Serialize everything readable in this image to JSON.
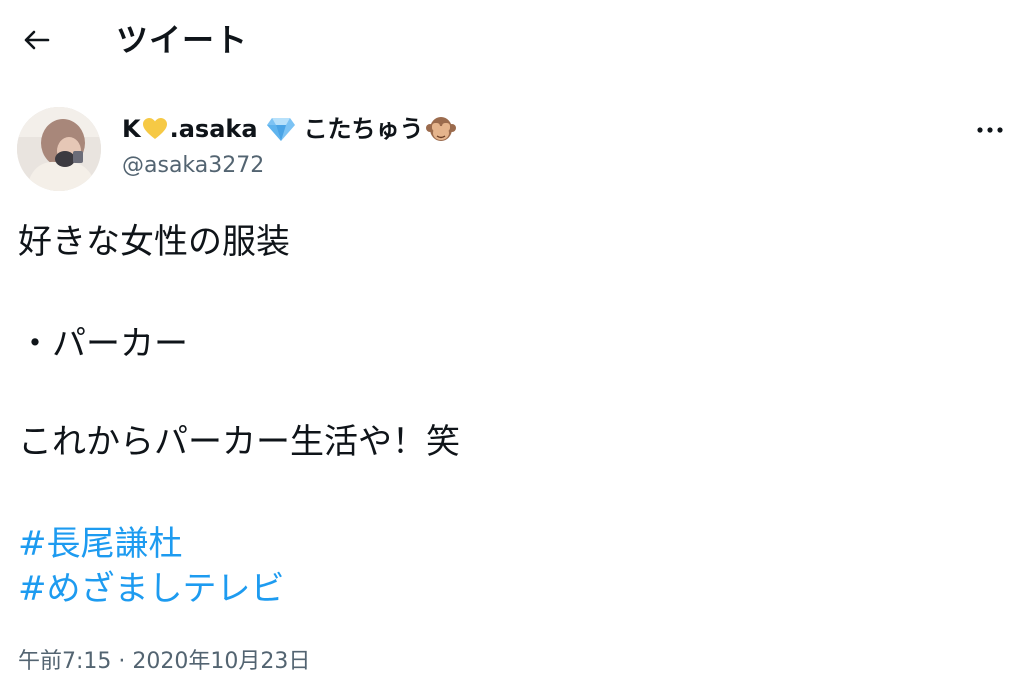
{
  "header": {
    "title": "ツイート",
    "back_icon": "arrow-left-icon"
  },
  "author": {
    "name_prefix": "K",
    "name_main": ".asaka",
    "name_suffix": "こたちゅう",
    "handle": "@asaka3272",
    "name_emoji_icons": [
      "yellow-heart-icon",
      "gem-icon",
      "see-no-evil-monkey-icon"
    ],
    "avatar_icon": "avatar"
  },
  "more_icon": "more-horizontal-icon",
  "tweet": {
    "line1": "好きな女性の服装",
    "line2": "・パーカー",
    "line3": "これからパーカー生活や！笑",
    "hashtags": [
      "#長尾謙杜",
      "#めざましテレビ"
    ]
  },
  "timestamp": "午前7:15 · 2020年10月23日",
  "colors": {
    "text": "#0f1419",
    "secondary": "#536471",
    "link": "#1d9bf0"
  }
}
